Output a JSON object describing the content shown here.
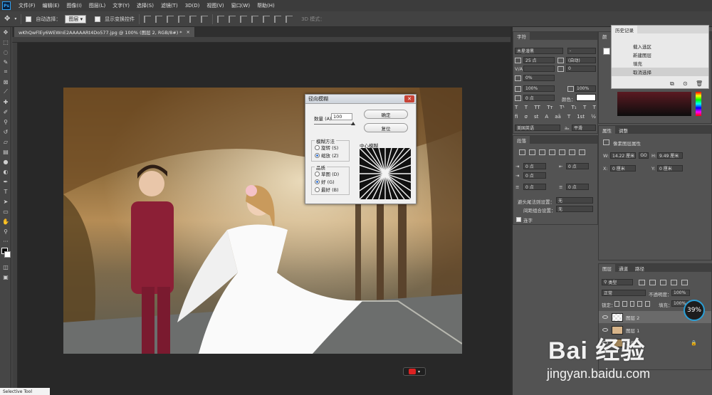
{
  "menu": [
    "文件(F)",
    "编辑(E)",
    "图像(I)",
    "图层(L)",
    "文字(Y)",
    "选择(S)",
    "滤镜(T)",
    "3D(D)",
    "视图(V)",
    "窗口(W)",
    "帮助(H)"
  ],
  "options": {
    "auto_select": "自动选择：",
    "auto_select_value": "图层",
    "show_transform": "显示变换控件",
    "mode_3d": "3D 模式："
  },
  "tab": {
    "title": "wKhQwFlEy6WEWnE2AAAAARt4Do577.jpg @ 100% (图层 2, RGB/8#) *"
  },
  "dialog": {
    "title": "径向模糊",
    "amount_label": "数量 (A)",
    "amount_value": "100",
    "ok": "确定",
    "reset": "复位",
    "blur_method_label": "模糊方法",
    "method_spin": "旋转 (S)",
    "method_zoom": "缩放 (Z)",
    "quality_label": "品质",
    "quality_draft": "草图 (D)",
    "quality_good": "好 (G)",
    "quality_best": "最好 (B)",
    "center_label": "中心模糊"
  },
  "character": {
    "tab": "字符",
    "font_family": "木星漫黑",
    "font_size": "25 点",
    "leading": "(自动)",
    "tracking": "0",
    "kerning_pct": "0%",
    "vscale": "100%",
    "hscale": "100%",
    "baseline": "0 点",
    "color_label": "颜色：",
    "language": "美国英语",
    "anti_alias": "平滑"
  },
  "paragraph": {
    "tab": "段落",
    "indent_left": "0 点",
    "indent_right": "0 点",
    "indent_first": "0 点",
    "space_before": "0 点",
    "space_after": "0 点",
    "kinsoku_label": "避头尾法则设置：",
    "kinsoku_value": "无",
    "mojikumi_label": "间距组合设置：",
    "mojikumi_value": "无",
    "hyphenate": "连字"
  },
  "history": {
    "tab": "历史记录",
    "items": [
      "载入选区",
      "新建图层",
      "填充",
      "取消选择"
    ]
  },
  "properties": {
    "tabs": [
      "属性",
      "调整"
    ],
    "title": "像素图层属性",
    "w_label": "W:",
    "w_value": "14.22 厘米",
    "h_label": "H:",
    "h_value": "9.49 厘米",
    "x_label": "X:",
    "x_value": "0 厘米",
    "y_label": "Y:",
    "y_value": "0 厘米",
    "link_label": "GO"
  },
  "layers": {
    "tabs": [
      "图层",
      "通道",
      "路径"
    ],
    "filter": "类型",
    "blend": "正常",
    "opacity_label": "不透明度：",
    "opacity": "100%",
    "lock_label": "锁定：",
    "fill_label": "填充：",
    "fill": "100%",
    "items": [
      "图层 2",
      "图层 1",
      "背景"
    ]
  },
  "badge": "39%",
  "status_popup": "Selective Tool",
  "watermark": {
    "logo": "Bai 经验",
    "url": "jingyan.baidu.com"
  },
  "colors": {
    "accent": "#2a9fd6",
    "panel": "#535353",
    "canvas": "#282828"
  }
}
